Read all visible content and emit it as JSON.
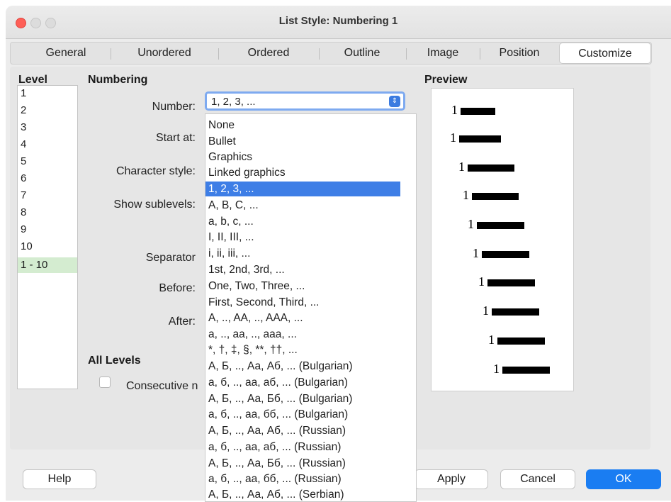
{
  "window": {
    "title": "List Style: Numbering 1"
  },
  "tabs": [
    "General",
    "Unordered",
    "Ordered",
    "Outline",
    "Image",
    "Position",
    "Customize"
  ],
  "selected_tab": "Customize",
  "level": {
    "heading": "Level",
    "items": [
      "1",
      "2",
      "3",
      "4",
      "5",
      "6",
      "7",
      "8",
      "9",
      "10",
      "1 - 10"
    ],
    "selected": "1 - 10"
  },
  "numbering": {
    "heading": "Numbering",
    "number_label": "Number:",
    "number_value": "1, 2, 3, ...",
    "start_at_label": "Start at:",
    "character_style_label": "Character style:",
    "show_sublevels_label": "Show sublevels:",
    "separator_label": "Separator",
    "before_label": "Before:",
    "after_label": "After:"
  },
  "dropdown": {
    "options": [
      "None",
      "Bullet",
      "Graphics",
      "Linked graphics",
      "1, 2, 3, ...",
      "A, B, C, ...",
      "a, b, c, ...",
      "I, II, III, ...",
      "i, ii, iii, ...",
      "1st, 2nd, 3rd, ...",
      "One, Two, Three, ...",
      "First, Second, Third, ...",
      "A, .., AA, .., AAA, ...",
      "a, .., aa, .., aaa, ...",
      "*, †, ‡, §, **, ††, ...",
      "А, Б, .., Аа, Аб, ... (Bulgarian)",
      "а, б, .., аа, аб, ... (Bulgarian)",
      "А, Б, .., Аа, Бб, ... (Bulgarian)",
      "а, б, .., аа, бб, ... (Bulgarian)",
      "А, Б, .., Аа, Аб, ... (Russian)",
      "а, б, .., аа, аб, ... (Russian)",
      "А, Б, .., Аа, Бб, ... (Russian)",
      "а, б, .., аа, бб, ... (Russian)",
      "А, Б, .., Аа, Аб, ... (Serbian)"
    ],
    "selected": "1, 2, 3, ..."
  },
  "preview": {
    "heading": "Preview",
    "item_label": "1"
  },
  "all_levels": {
    "heading": "All Levels",
    "consecutive_label": "Consecutive n"
  },
  "buttons": {
    "help": "Help",
    "apply": "Apply",
    "cancel": "Cancel",
    "ok": "OK"
  }
}
